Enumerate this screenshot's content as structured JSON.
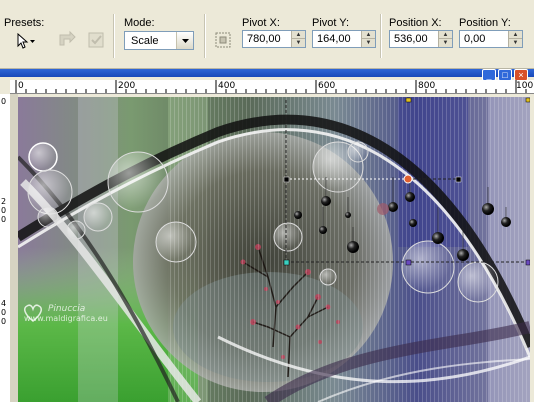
{
  "toolbar": {
    "presets_label": "Presets:",
    "mode_label": "Mode:",
    "mode_value": "Scale",
    "pivot_x_label": "Pivot X:",
    "pivot_x_value": "780,00",
    "pivot_y_label": "Pivot Y:",
    "pivot_y_value": "164,00",
    "position_x_label": "Position X:",
    "position_x_value": "536,00",
    "position_y_label": "Position Y:",
    "position_y_value": "0,00"
  },
  "ruler": {
    "h_labels": [
      "0",
      "200",
      "400",
      "600",
      "800",
      "100"
    ],
    "v_labels": [
      "0",
      "2",
      "0",
      "0",
      "4",
      "0",
      "0"
    ]
  },
  "watermark": {
    "name": "Pinuccia",
    "url": "www.maldigrafica.eu"
  },
  "colors": {
    "toolbar_bg": "#ece9d8",
    "title_blue": "#1e50c8",
    "canvas_green": "#4aa83a",
    "canvas_purple": "#5a4a8a"
  },
  "icons": {
    "presets": "pointer-arrow-icon",
    "mode_dropdown": "chevron-down-icon",
    "spin": "spin-arrows-icon"
  }
}
